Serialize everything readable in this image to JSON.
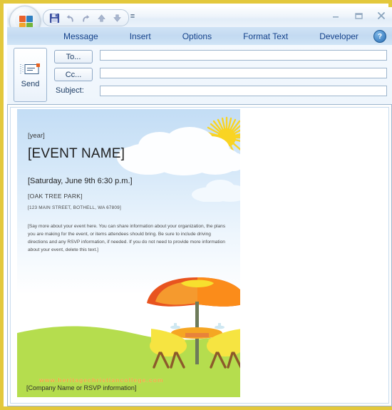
{
  "window": {
    "frame_color": "#e3c83c",
    "controls": [
      {
        "name": "minimize",
        "glyph": "–"
      },
      {
        "name": "restore",
        "glyph": "▭"
      },
      {
        "name": "close",
        "glyph": "✕"
      }
    ]
  },
  "quick_access": {
    "buttons": [
      {
        "name": "save",
        "label": "Save"
      },
      {
        "name": "undo",
        "label": "Undo"
      },
      {
        "name": "redo",
        "label": "Redo"
      },
      {
        "name": "previous-item",
        "label": "Previous Item"
      },
      {
        "name": "next-item",
        "label": "Next Item"
      }
    ],
    "customize_glyph": "≡"
  },
  "ribbon": {
    "tabs": [
      {
        "label": "Message",
        "active": true
      },
      {
        "label": "Insert",
        "active": false
      },
      {
        "label": "Options",
        "active": false
      },
      {
        "label": "Format Text",
        "active": false
      },
      {
        "label": "Developer",
        "active": false
      }
    ],
    "help_glyph": "?"
  },
  "compose": {
    "send_label": "Send",
    "to_label": "To...",
    "cc_label": "Cc...",
    "subject_label": "Subject:",
    "to_value": "",
    "cc_value": "",
    "subject_value": "",
    "to_placeholder": "",
    "cc_placeholder": "",
    "subject_placeholder": ""
  },
  "flyer": {
    "year": "[year]",
    "event_name": "[EVENT NAME]",
    "date": "[Saturday, June 9th 6:30 p.m.]",
    "venue": "[OAK TREE PARK]",
    "address": "[123 MAIN STREET, BOTHELL, WA 67809]",
    "body": "[Say more about your event here. You can share information about your organization, the plans you are making for the event, or items attendees should bring.  Be sure to include driving directions and any RSVP information, if needed. If you do not need to provide more information about your event, delete this text.]",
    "watermark": "www.heritagechristiancollege.com",
    "footer": "[Company Name or RSVP information]",
    "colors": {
      "sky_top": "#c3ddf5",
      "sky_bottom": "#ffffff",
      "grass": "#b5dd4e",
      "sun": "#f9d423",
      "umbrella_outer": "#e8541f",
      "umbrella_mid": "#f59a2e",
      "umbrella_inner": "#fb8c1a",
      "umbrella_top": "#f7e02e",
      "chair": "#f6e441",
      "table": "#f5a623",
      "legs": "#8c5a2b",
      "watermark": "#f0a83a"
    }
  }
}
